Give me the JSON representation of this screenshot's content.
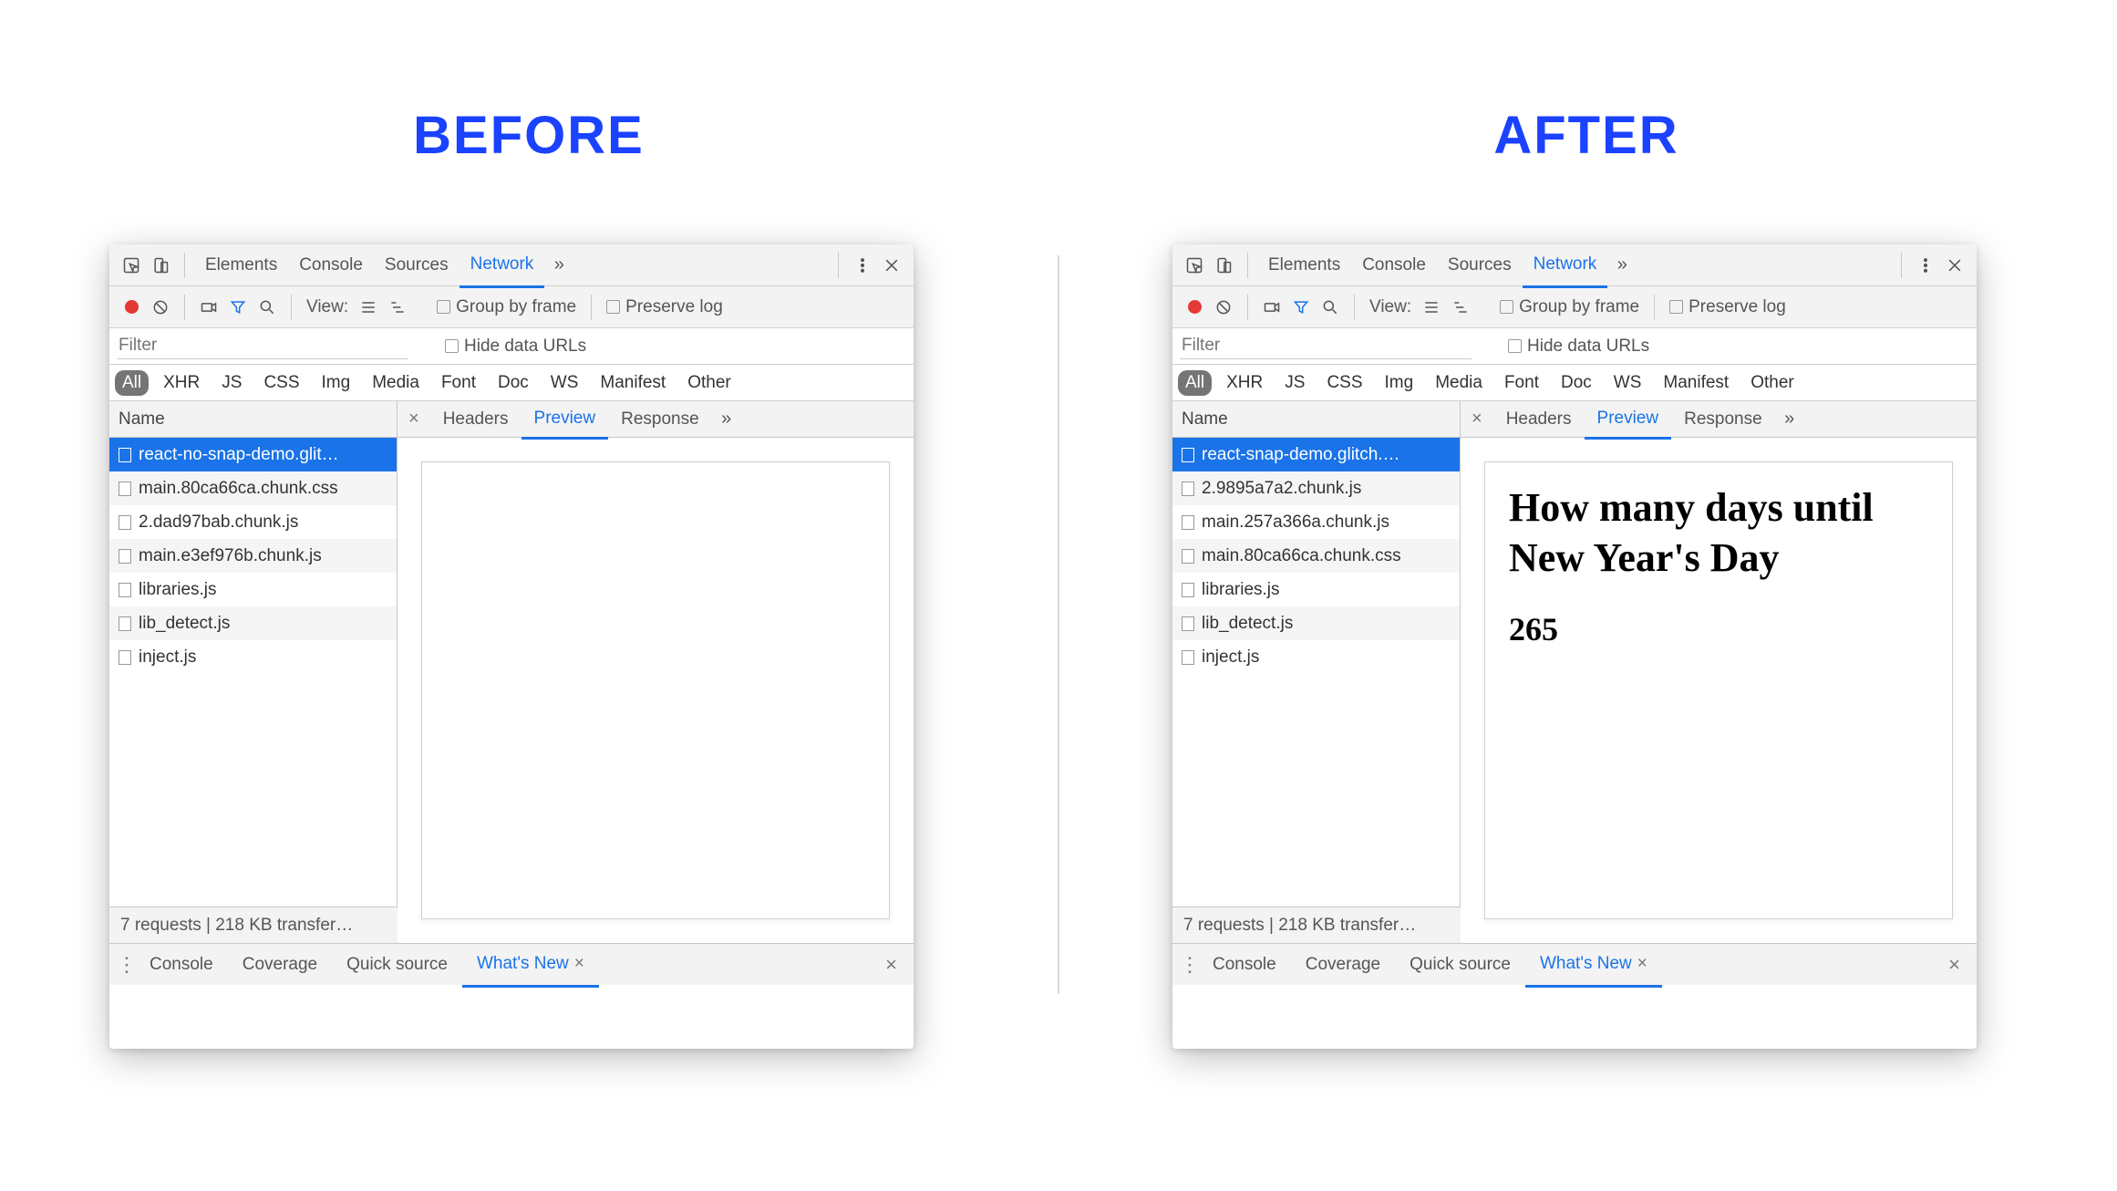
{
  "headings": {
    "before": "BEFORE",
    "after": "AFTER"
  },
  "top_tabs": [
    "Elements",
    "Console",
    "Sources",
    "Network"
  ],
  "top_active": "Network",
  "toolbar": {
    "view_label": "View:",
    "group_by_frame": "Group by frame",
    "preserve_log": "Preserve log"
  },
  "filter": {
    "placeholder": "Filter",
    "hide_data_urls": "Hide data URLs"
  },
  "type_tags": [
    "All",
    "XHR",
    "JS",
    "CSS",
    "Img",
    "Media",
    "Font",
    "Doc",
    "WS",
    "Manifest",
    "Other"
  ],
  "type_tag_active": "All",
  "columns": {
    "name": "Name"
  },
  "detail_tabs": [
    "Headers",
    "Preview",
    "Response"
  ],
  "detail_tab_active": "Preview",
  "status_text": "7 requests | 218 KB transfer…",
  "drawer_tabs": [
    "Console",
    "Coverage",
    "Quick source",
    "What's New"
  ],
  "drawer_active": "What's New",
  "before": {
    "requests": [
      "react-no-snap-demo.glit…",
      "main.80ca66ca.chunk.css",
      "2.dad97bab.chunk.js",
      "main.e3ef976b.chunk.js",
      "libraries.js",
      "lib_detect.js",
      "inject.js"
    ],
    "selected_index": 0,
    "preview": {
      "title": "",
      "value": ""
    }
  },
  "after": {
    "requests": [
      "react-snap-demo.glitch.…",
      "2.9895a7a2.chunk.js",
      "main.257a366a.chunk.js",
      "main.80ca66ca.chunk.css",
      "libraries.js",
      "lib_detect.js",
      "inject.js"
    ],
    "selected_index": 0,
    "preview": {
      "title": "How many days until New Year's Day",
      "value": "265"
    }
  }
}
